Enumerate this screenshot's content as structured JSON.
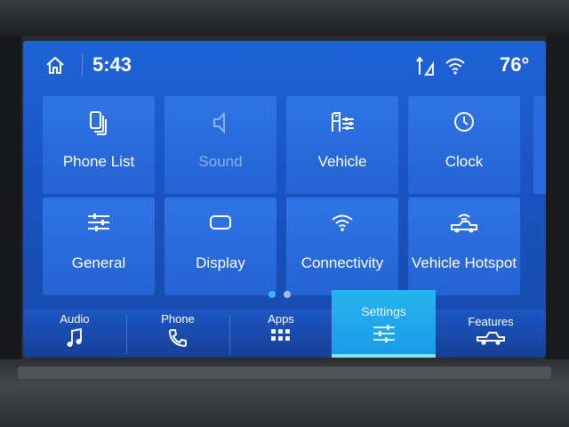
{
  "status": {
    "time": "5:43",
    "temperature": "76°"
  },
  "tiles": [
    {
      "label": "Phone List",
      "icon": "phone-list-icon"
    },
    {
      "label": "Sound",
      "icon": "speaker-icon"
    },
    {
      "label": "Vehicle",
      "icon": "vehicle-settings-icon"
    },
    {
      "label": "Clock",
      "icon": "clock-icon"
    },
    {
      "label": "General",
      "icon": "sliders-icon"
    },
    {
      "label": "Display",
      "icon": "display-icon"
    },
    {
      "label": "Connectivity",
      "icon": "wifi-icon"
    },
    {
      "label": "Vehicle Hotspot",
      "icon": "hotspot-icon"
    }
  ],
  "pager": {
    "pages": 2,
    "current": 1
  },
  "nav": [
    {
      "label": "Audio",
      "icon": "music-note-icon"
    },
    {
      "label": "Phone",
      "icon": "phone-handset-icon"
    },
    {
      "label": "Apps",
      "icon": "apps-grid-icon"
    },
    {
      "label": "Settings",
      "icon": "settings-sliders-icon",
      "active": true
    },
    {
      "label": "Features",
      "icon": "truck-icon"
    }
  ],
  "colors": {
    "screen": "#1f63d8",
    "tile": "#2f74e6",
    "active_nav": "#25b6f0",
    "dim_label": "#8fb1ea"
  }
}
